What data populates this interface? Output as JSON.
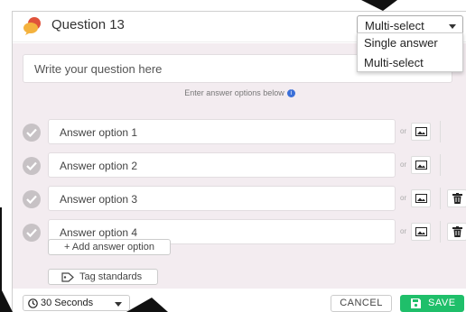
{
  "header": {
    "title": "Question 13",
    "question_type": {
      "selected": "Multi-select",
      "options": [
        "Single answer",
        "Multi-select"
      ]
    }
  },
  "question": {
    "placeholder": "Write your question here",
    "hint": "Enter answer options below"
  },
  "answers": [
    {
      "placeholder": "Answer option 1",
      "or": "or",
      "deletable": false
    },
    {
      "placeholder": "Answer option 2",
      "or": "or",
      "deletable": false
    },
    {
      "placeholder": "Answer option 3",
      "or": "or",
      "deletable": true
    },
    {
      "placeholder": "Answer option 4",
      "or": "or",
      "deletable": true
    }
  ],
  "actions": {
    "add_answer": "+ Add answer option",
    "tag_standards": "Tag standards"
  },
  "footer": {
    "time_limit": "30 Seconds",
    "cancel": "CANCEL",
    "save": "SAVE"
  },
  "colors": {
    "accent_save": "#1fbf6a",
    "body_background": "#f3ecf0",
    "info_icon": "#3b6fd8"
  },
  "icons": {
    "question": "speech-bubbles-icon",
    "check": "checkmark-icon",
    "image": "image-icon",
    "delete": "trash-icon",
    "tag": "tag-icon",
    "clock": "clock-icon",
    "save": "floppy-disk-icon"
  }
}
